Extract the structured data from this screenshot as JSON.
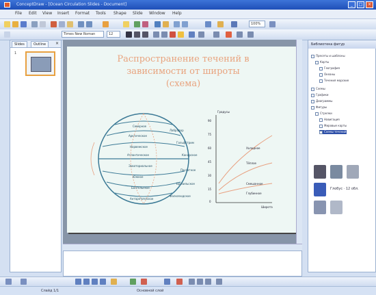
{
  "window": {
    "title": "ConceptDraw - [Ocean Circulation Slides - Document]"
  },
  "menu": [
    "File",
    "Edit",
    "View",
    "Insert",
    "Format",
    "Tools",
    "Shape",
    "Slide",
    "Window",
    "Help"
  ],
  "toolbar": {
    "font_combo": "Times New Roman",
    "size_combo": "12",
    "zoom_combo": "100%"
  },
  "left_panel": {
    "tabs": [
      "Slides",
      "Outline"
    ],
    "slide_number": "1"
  },
  "slide": {
    "title_lines": [
      "Распространение течений в",
      "зависимости от широты",
      "(схема)"
    ],
    "globe_labels": [
      "Северное",
      "Арктическое",
      "Норвежское",
      "Атлантическое",
      "Экваториальное",
      "Южное",
      "Бенгельское",
      "Антарктическое"
    ],
    "globe_side_labels": [
      "Лабрадор",
      "Гольфстрим",
      "Канарское",
      "Пассатное",
      "Бразильское",
      "Фолклендское"
    ],
    "chart_title": "Градусы",
    "chart_ticks": [
      "90",
      "75",
      "60",
      "45",
      "30",
      "15",
      "0"
    ],
    "chart_series_labels": [
      "Холодное",
      "Тёплое",
      "Смешанное",
      "Глубинное"
    ],
    "chart_xlabel": "Широта"
  },
  "right_panel": {
    "header": "Библиотека фигур",
    "tree": [
      "Пресеты и шаблоны",
      "Карты",
      "География",
      "Океаны",
      "Течения морские",
      "Схемы",
      "Графики",
      "Диаграммы",
      "Фигуры",
      "Стрелки",
      "Навигация",
      "Мировые карты",
      "Схемы течений"
    ],
    "gallery_caption": "Глобус · 12 обл."
  },
  "statusbar": {
    "slide": "Слайд 1/1",
    "layer": "Основной слой"
  },
  "colors": {
    "title_orange": "#e8956a",
    "accent": "#2d4fa8",
    "slide_bg": "#eef7f4"
  }
}
